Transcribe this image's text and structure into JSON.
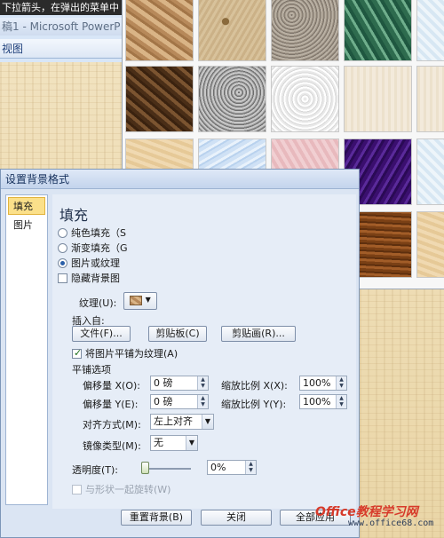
{
  "window": {
    "hint_text": "下拉箭头，在弹出的菜单中",
    "app_title": "稿1 - Microsoft PowerP",
    "ribbon_tab": "视图"
  },
  "gallery": {
    "textures": [
      {
        "name": "paper-bag"
      },
      {
        "name": "fish-fossil"
      },
      {
        "name": "granite"
      },
      {
        "name": "green-marble"
      },
      {
        "name": "brown-marble"
      },
      {
        "name": "gray-granite"
      },
      {
        "name": "white-marble"
      },
      {
        "name": "canvas"
      },
      {
        "name": "sand"
      },
      {
        "name": "blue-tissue"
      },
      {
        "name": "pink-tissue"
      },
      {
        "name": "purple-mesh"
      },
      {
        "name": "cork"
      },
      {
        "name": "walnut"
      },
      {
        "name": "oak"
      },
      {
        "name": "medium-wood"
      }
    ]
  },
  "dialog": {
    "title": "设置背景格式",
    "nav": [
      "填充",
      "图片"
    ],
    "section_title": "填充",
    "fill_options": [
      "纯色填充（S",
      "渐变填充（G",
      "图片或纹理"
    ],
    "selected_fill_index": 2,
    "hide_bg_label": "隐藏背景图",
    "texture_label": "纹理(U):",
    "insert_from_label": "插入自:",
    "file_button": "文件(F)...",
    "clipboard_button": "剪贴板(C)",
    "clipart_button": "剪贴画(R)...",
    "tile_checkbox": "将图片平铺为纹理(A)",
    "tile_checked": true,
    "tile_options_title": "平铺选项",
    "offset_x_label": "偏移量 X(O):",
    "offset_x_value": "0 磅",
    "offset_y_label": "偏移量 Y(E):",
    "offset_y_value": "0 磅",
    "scale_x_label": "缩放比例 X(X):",
    "scale_x_value": "100%",
    "scale_y_label": "缩放比例 Y(Y):",
    "scale_y_value": "100%",
    "align_label": "对齐方式(M):",
    "align_value": "左上对齐",
    "mirror_label": "镜像类型(M):",
    "mirror_value": "无",
    "transparency_label": "透明度(T):",
    "transparency_value": "0%",
    "rotate_label": "与形状一起旋转(W)",
    "reset_button": "重置背景(B)",
    "close_button": "关闭",
    "apply_all_button": "全部应用"
  },
  "watermark": {
    "brand": "Office教程学习网",
    "url": "www.office68.com"
  }
}
